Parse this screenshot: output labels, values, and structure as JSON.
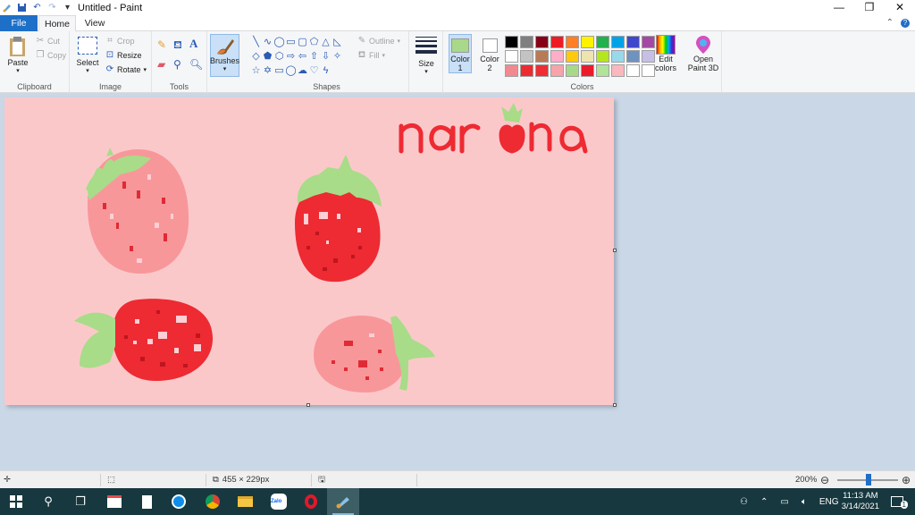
{
  "window": {
    "title": "Untitled - Paint"
  },
  "tabs": {
    "file": "File",
    "home": "Home",
    "view": "View"
  },
  "clipboard": {
    "paste": "Paste",
    "cut": "Cut",
    "copy": "Copy",
    "label": "Clipboard"
  },
  "image": {
    "select": "Select",
    "crop": "Crop",
    "resize": "Resize",
    "rotate": "Rotate",
    "label": "Image"
  },
  "tools": {
    "label": "Tools",
    "text_glyph": "A"
  },
  "brushes": {
    "label": "Brushes"
  },
  "shapes": {
    "outline": "Outline",
    "fill": "Fill",
    "label": "Shapes"
  },
  "size": {
    "label": "Size"
  },
  "colors": {
    "color1_label": "Color",
    "color1_num": "1",
    "color1_value": "#a8d98a",
    "color2_label": "Color",
    "color2_num": "2",
    "color2_value": "#ffffff",
    "edit": "Edit",
    "edit2": "colors",
    "label": "Colors",
    "palette": [
      "#000000",
      "#7f7f7f",
      "#880015",
      "#ed1c24",
      "#ff7f27",
      "#fff200",
      "#22b14c",
      "#00a2e8",
      "#3f48cc",
      "#a349a4",
      "#ffffff",
      "#c3c3c3",
      "#b97a57",
      "#ffaec9",
      "#ffc90e",
      "#efe4b0",
      "#b5e61d",
      "#99d9ea",
      "#7092be",
      "#c8bfe7",
      "#f08a90",
      "#ed2a30",
      "#ee2d35",
      "#f7a3ab",
      "#a8d98a",
      "#ea1c2c",
      "#b1e39a",
      "#f9b8be",
      "#ffffff",
      "#ffffff"
    ]
  },
  "paint3d": {
    "line1": "Open",
    "line2": "Paint 3D"
  },
  "artwork": {
    "background": "#fbc8ca",
    "signature": "narina",
    "strawberry_colors": {
      "pink": "#f8979a",
      "red": "#ee2a32",
      "leaf": "#a8dc88",
      "dark_seed": "#d01a28",
      "light_seed": "#fccfd4"
    }
  },
  "status": {
    "dimensions": "455 × 229px",
    "zoom": "200%",
    "zoom_fraction": 0.52
  },
  "taskbar": {
    "lang": "ENG",
    "time": "11:13 AM",
    "date": "3/14/2021",
    "notifications": "1"
  }
}
